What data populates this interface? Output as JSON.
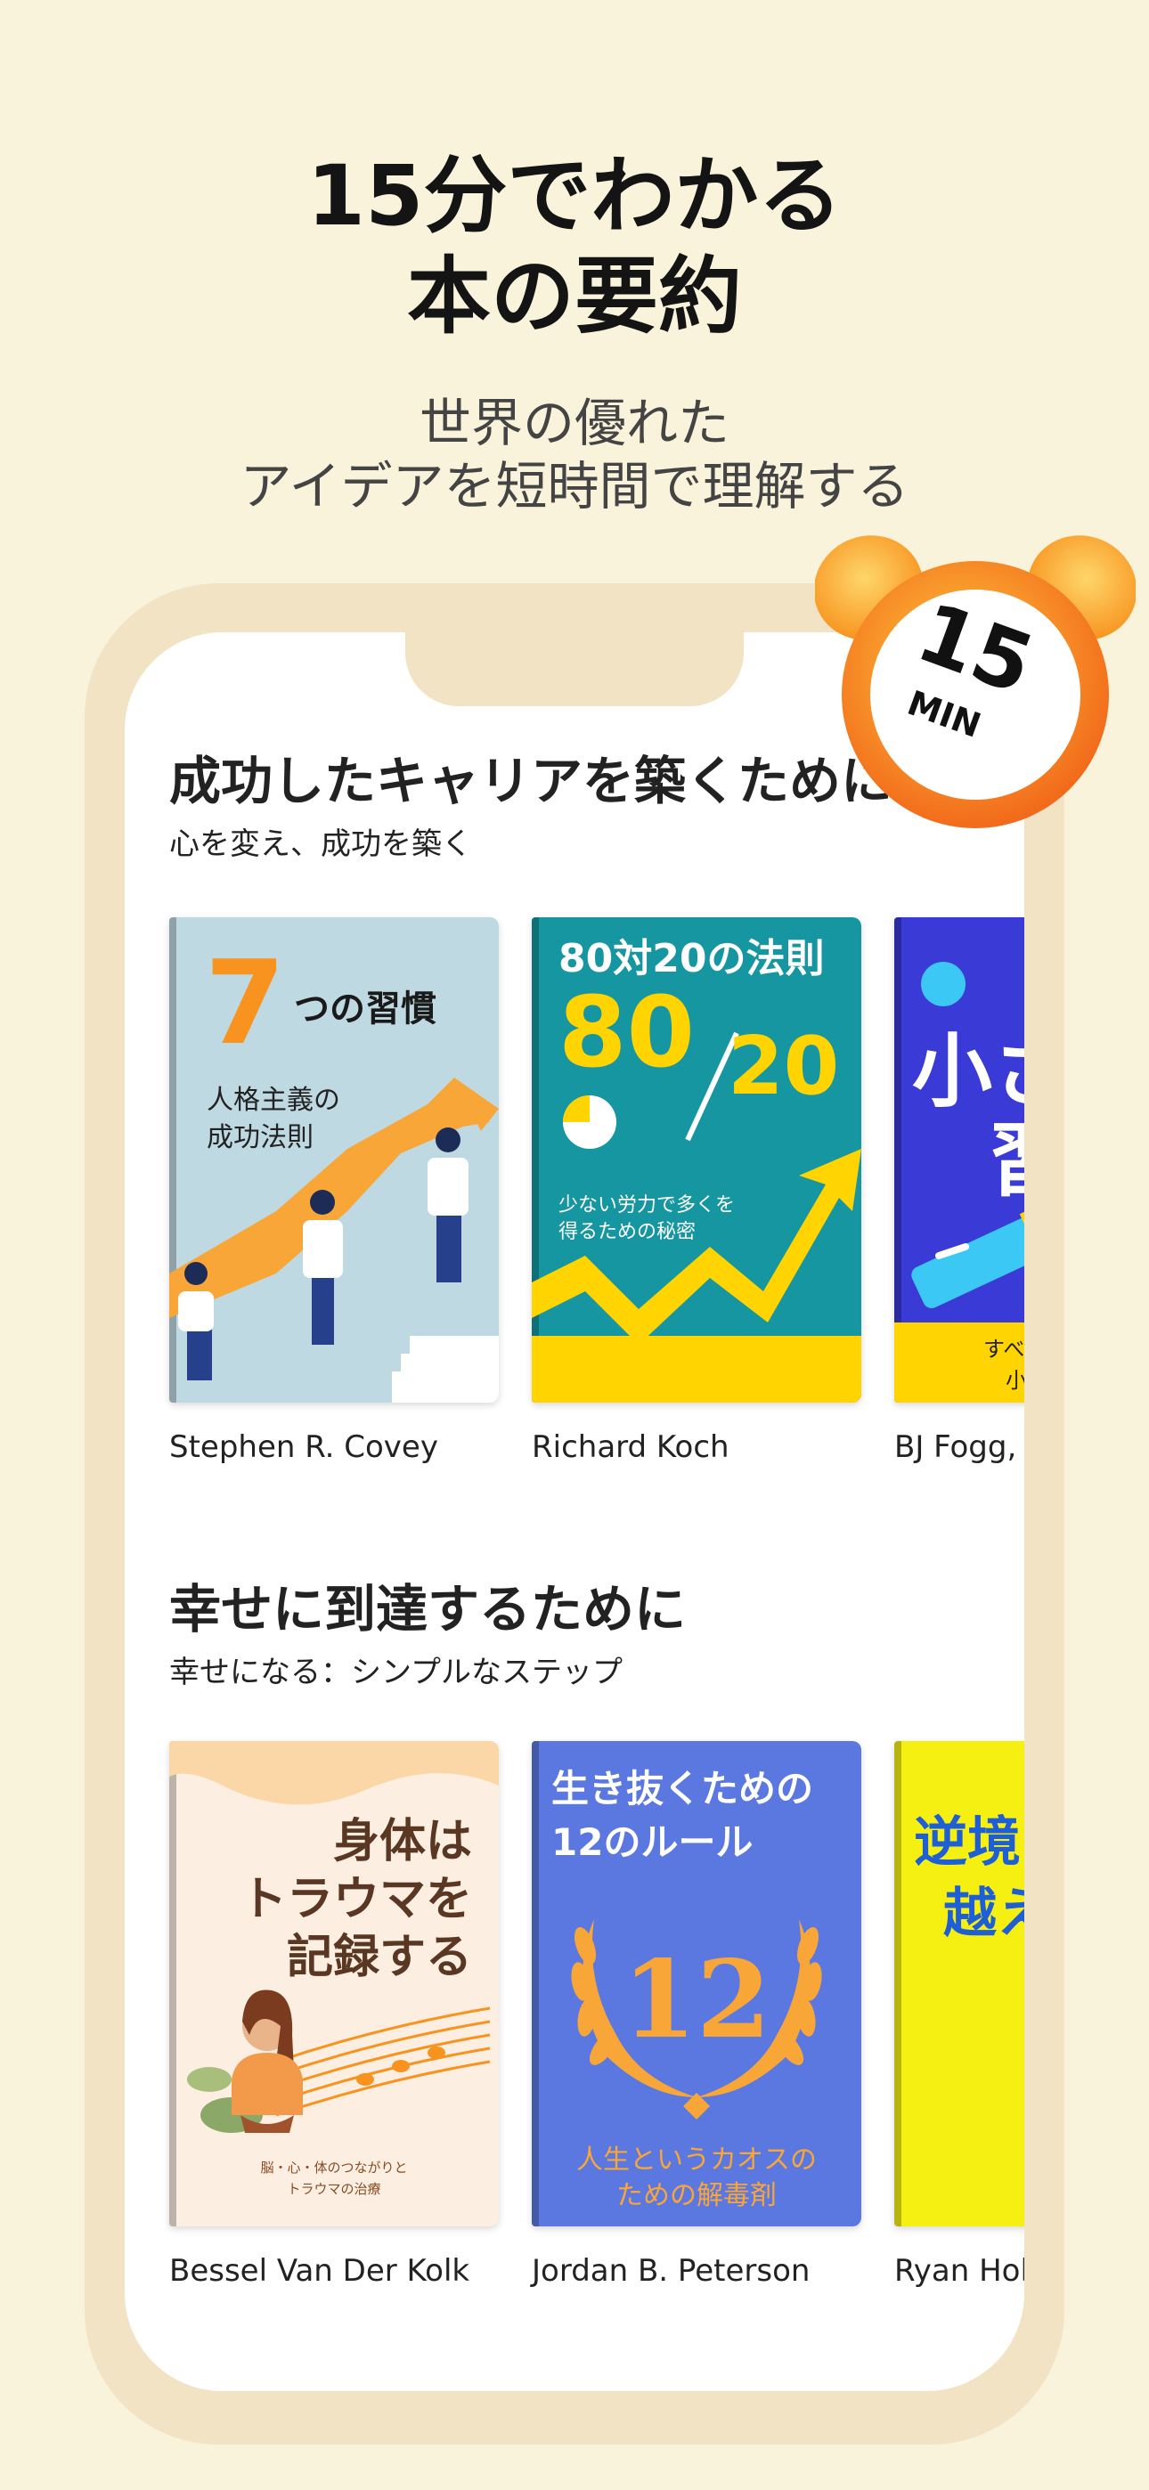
{
  "headline": {
    "line1": "15分でわかる",
    "line2": "本の要約"
  },
  "subheadline": {
    "line1": "世界の優れた",
    "line2": "アイデアを短時間で理解する"
  },
  "badge": {
    "number": "15",
    "unit": "MIN"
  },
  "sections": [
    {
      "title": "成功したキャリアを築くために",
      "subtitle": "心を変え、成功を築く",
      "books": [
        {
          "cover_lines": [
            "7",
            "つの習慣",
            "人格主義の",
            "成功法則"
          ],
          "author": "Stephen R. Covey"
        },
        {
          "cover_lines": [
            "80対20の法則",
            "80",
            "20",
            "少ない労力で多くを",
            "得るための秘密"
          ],
          "author": "Richard Koch"
        },
        {
          "cover_lines": [
            "小さ",
            "習",
            "すべ",
            "小"
          ],
          "author": "BJ Fogg,"
        }
      ]
    },
    {
      "title": "幸せに到達するために",
      "subtitle": "幸せになる：シンプルなステップ",
      "books": [
        {
          "cover_lines": [
            "身体は",
            "トラウマを",
            "記録する",
            "脳・心・体のつながりと",
            "トラウマの治療"
          ],
          "author": "Bessel Van Der Kolk"
        },
        {
          "cover_lines": [
            "生き抜くための",
            "12のルール",
            "12",
            "人生というカオスの",
            "ための解毒剤"
          ],
          "author": "Jordan B. Peterson"
        },
        {
          "cover_lines": [
            "逆境",
            "越え"
          ],
          "author": "Ryan Holi"
        }
      ]
    }
  ],
  "colors": {
    "background": "#FAF3DB",
    "frame": "#F2E3C4",
    "accent_orange": "#F7931E",
    "clock_yellow": "#FFC93C"
  }
}
